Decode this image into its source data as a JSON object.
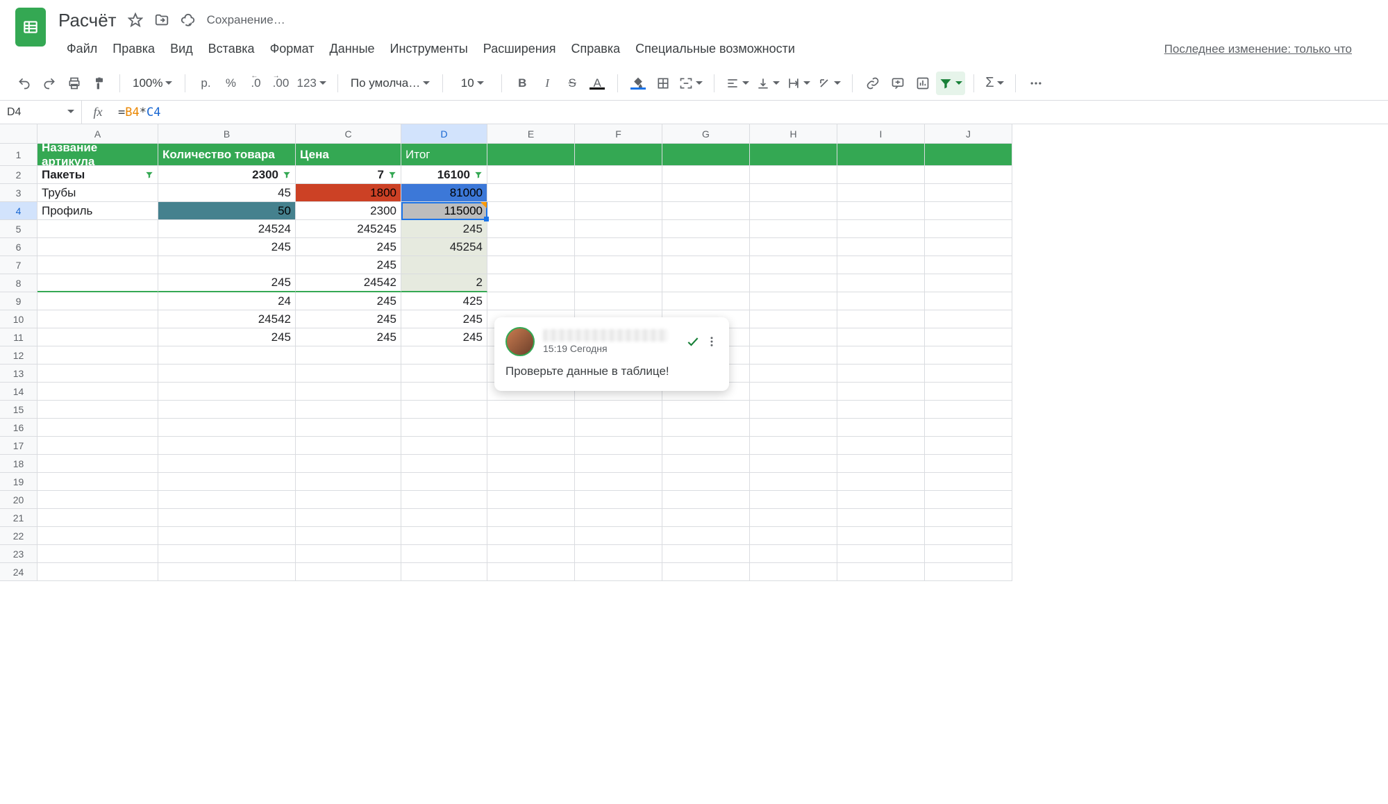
{
  "doc": {
    "title": "Расчёт",
    "saving": "Сохранение…",
    "last_edit": "Последнее изменение: только что"
  },
  "menus": [
    "Файл",
    "Правка",
    "Вид",
    "Вставка",
    "Формат",
    "Данные",
    "Инструменты",
    "Расширения",
    "Справка",
    "Специальные возможности"
  ],
  "toolbar": {
    "zoom": "100%",
    "currency": "р.",
    "percent": "%",
    "dec_dec": ".0",
    "inc_dec": ".00",
    "num_fmt": "123",
    "font": "По умолча…",
    "size": "10"
  },
  "namebox": "D4",
  "formula": {
    "eq": "=",
    "ref1": "B4",
    "op": "*",
    "ref2": "C4"
  },
  "columns": [
    "A",
    "B",
    "C",
    "D",
    "E",
    "F",
    "G",
    "H",
    "I",
    "J"
  ],
  "row_numbers": [
    1,
    2,
    3,
    4,
    5,
    6,
    7,
    8,
    9,
    10,
    11,
    12,
    13,
    14,
    15,
    16,
    17,
    18,
    19,
    20,
    21,
    22,
    23,
    24
  ],
  "data": {
    "head": [
      "Название артикула",
      "Количество товара",
      "Цена",
      "Итог"
    ],
    "rows": [
      [
        "Пакеты",
        "2300",
        "7",
        "16100"
      ],
      [
        "Трубы",
        "45",
        "1800",
        "81000"
      ],
      [
        "Профиль",
        "50",
        "2300",
        "115000"
      ],
      [
        "",
        "24524",
        "245245",
        "245"
      ],
      [
        "",
        "245",
        "245",
        "45254"
      ],
      [
        "",
        "",
        "245",
        ""
      ],
      [
        "",
        "245",
        "24542",
        "2"
      ],
      [
        "",
        "24",
        "245",
        "425"
      ],
      [
        "",
        "24542",
        "245",
        "245"
      ],
      [
        "",
        "245",
        "245",
        "245"
      ]
    ]
  },
  "comment": {
    "time": "15:19 Сегодня",
    "text": "Проверьте данные в таблице!"
  },
  "icons": {
    "star": "star-outline-icon",
    "move": "move-to-folder-icon",
    "cloud": "cloud-sync-icon",
    "undo": "undo-icon",
    "redo": "redo-icon",
    "print": "print-icon",
    "paint": "paint-format-icon",
    "bold": "B",
    "italic": "I",
    "strike": "S",
    "textcolor": "A",
    "filter": "filter-icon"
  }
}
